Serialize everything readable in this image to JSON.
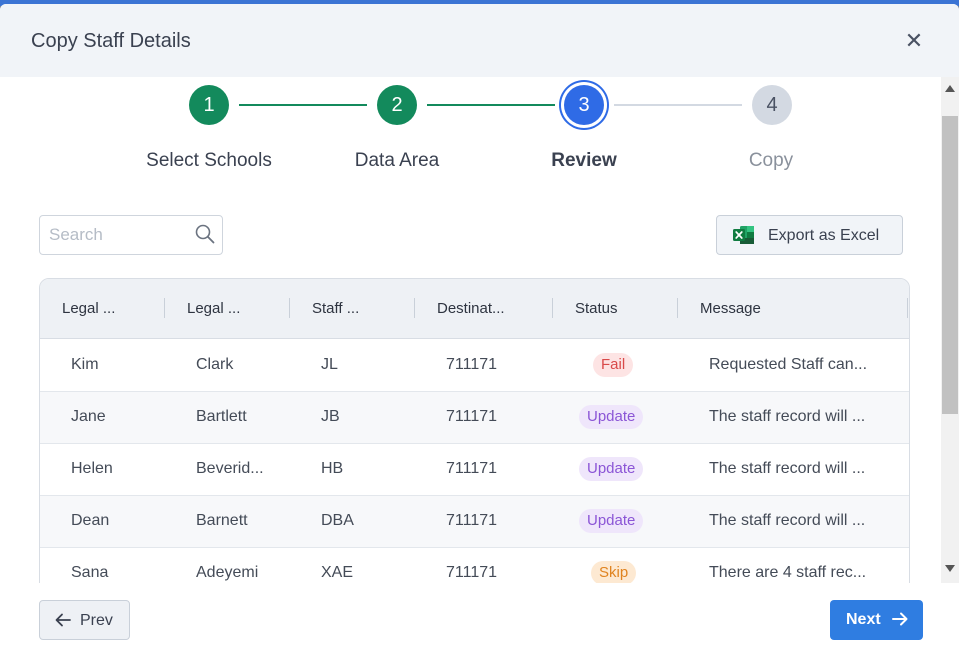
{
  "dialog": {
    "title": "Copy Staff Details",
    "close_glyph": "✕"
  },
  "steps": [
    {
      "number": "1",
      "label": "Select Schools",
      "state": "done"
    },
    {
      "number": "2",
      "label": "Data Area",
      "state": "done"
    },
    {
      "number": "3",
      "label": "Review",
      "state": "current"
    },
    {
      "number": "4",
      "label": "Copy",
      "state": "todo"
    }
  ],
  "toolbar": {
    "search_placeholder": "Search",
    "export_label": "Export as Excel"
  },
  "table": {
    "columns": [
      "Legal ...",
      "Legal ...",
      "Staff ...",
      "Destinat...",
      "Status",
      "Message"
    ],
    "rows": [
      {
        "first": "Kim",
        "last": "Clark",
        "code": "JL",
        "dest": "711171",
        "status": "Fail",
        "status_type": "fail",
        "message": "Requested Staff can..."
      },
      {
        "first": "Jane",
        "last": "Bartlett",
        "code": "JB",
        "dest": "711171",
        "status": "Update",
        "status_type": "update",
        "message": "The staff record will ..."
      },
      {
        "first": "Helen",
        "last": "Beverid...",
        "code": "HB",
        "dest": "711171",
        "status": "Update",
        "status_type": "update",
        "message": "The staff record will ..."
      },
      {
        "first": "Dean",
        "last": "Barnett",
        "code": "DBA",
        "dest": "711171",
        "status": "Update",
        "status_type": "update",
        "message": "The staff record will ..."
      },
      {
        "first": "Sana",
        "last": "Adeyemi",
        "code": "XAE",
        "dest": "711171",
        "status": "Skip",
        "status_type": "skip",
        "message": "There are 4 staff rec..."
      }
    ]
  },
  "footer": {
    "prev_label": "Prev",
    "next_label": "Next"
  },
  "colors": {
    "done": "#138a5c",
    "current": "#2f6be6",
    "primary_button": "#2f7de1"
  }
}
